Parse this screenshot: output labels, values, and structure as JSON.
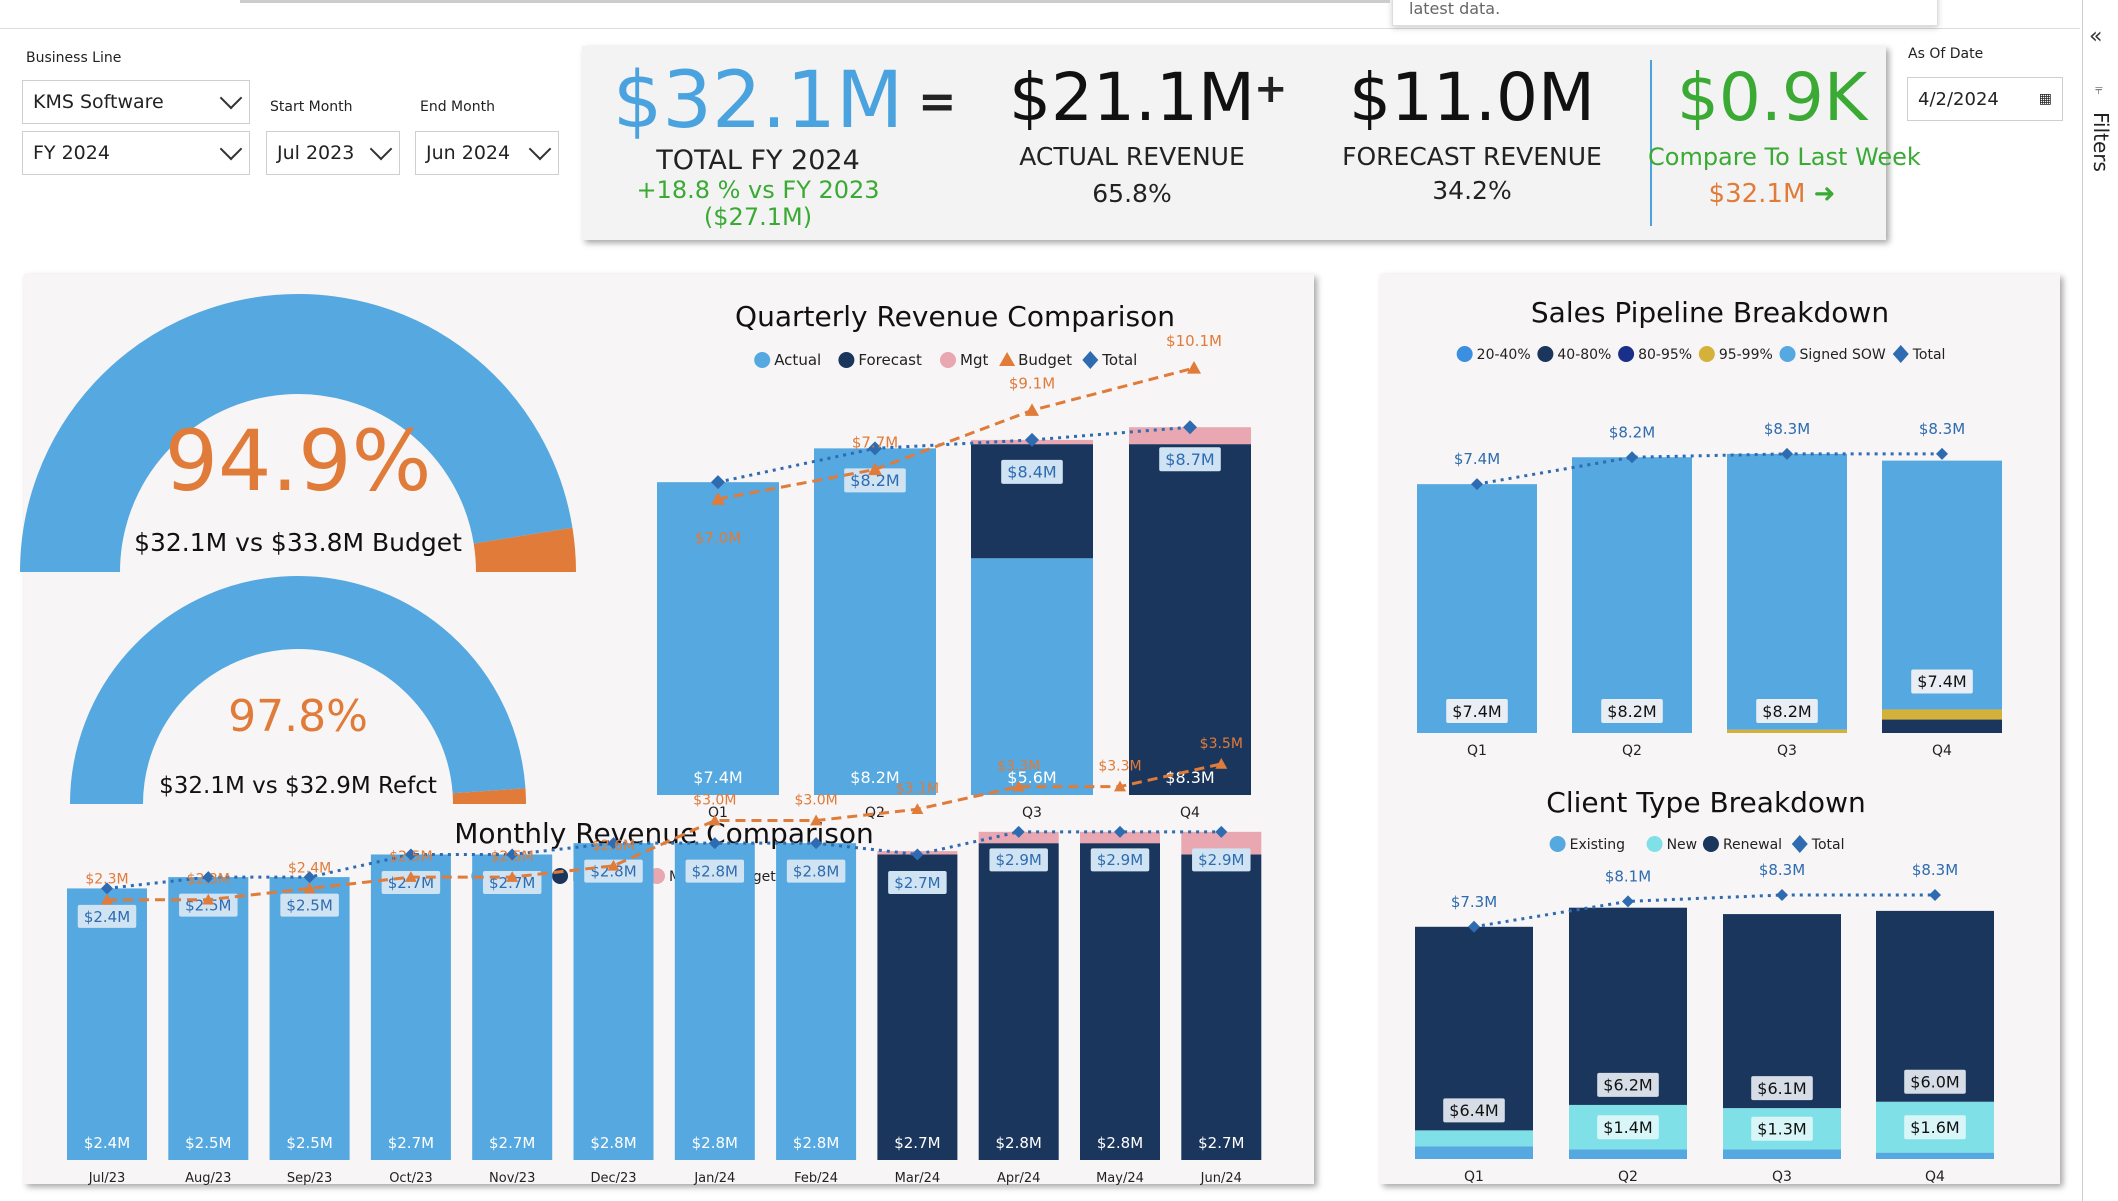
{
  "filters": {
    "business_line_label": "Business Line",
    "business_line_value": "KMS Software",
    "fiscal_year_value": "FY 2024",
    "start_month_label": "Start Month",
    "start_month_value": "Jul 2023",
    "end_month_label": "End Month",
    "end_month_value": "Jun 2024",
    "as_of_label": "As Of Date",
    "as_of_value": "4/2/2024",
    "filters_pane_label": "Filters",
    "tooltip_partial": "latest data."
  },
  "kpis": {
    "total_value": "$32.1M",
    "total_label": "TOTAL FY 2024",
    "total_change": "+18.8 % vs FY 2023",
    "total_prev": "($27.1M)",
    "equals": "=",
    "plus": "+",
    "actual_value": "$21.1M",
    "actual_label": "ACTUAL REVENUE",
    "actual_pct": "65.8%",
    "forecast_value": "$11.0M",
    "forecast_label": "FORECAST REVENUE",
    "forecast_pct": "34.2%",
    "week_value": "$0.9K",
    "week_label": "Compare To Last Week",
    "week_prev": "$32.1M",
    "colors": {
      "blue": "#4aa3df",
      "green": "#3aaa35",
      "orange": "#e07b39"
    }
  },
  "gauges": [
    {
      "pct_value": 94.9,
      "pct_text": "94.9%",
      "sub": "$32.1M vs $33.8M Budget"
    },
    {
      "pct_value": 97.8,
      "pct_text": "97.8%",
      "sub": "$32.1M vs $32.9M Refct"
    }
  ],
  "chart_data": [
    {
      "type": "bar",
      "title": "Quarterly Revenue Comparison",
      "legend": [
        "Actual",
        "Forecast",
        "Mgt",
        "Budget",
        "Total"
      ],
      "categories": [
        "Q1",
        "Q2",
        "Q3",
        "Q4"
      ],
      "series": [
        {
          "name": "Actual",
          "values": [
            7.4,
            8.2,
            5.6,
            0
          ],
          "labels": [
            "$7.4M",
            "$8.2M",
            "$5.6M",
            ""
          ]
        },
        {
          "name": "Forecast",
          "values": [
            0,
            0,
            2.7,
            8.3
          ],
          "labels": [
            "",
            "",
            "$2.7M",
            "$8.3M"
          ]
        },
        {
          "name": "Mgt",
          "values": [
            0,
            0,
            0.1,
            0.4
          ]
        },
        {
          "name": "Budget",
          "values": [
            7.0,
            7.7,
            9.1,
            10.1
          ],
          "labels": [
            "$7.0M",
            "$7.7M",
            "$9.1M",
            "$10.1M"
          ]
        },
        {
          "name": "Total",
          "values": [
            7.4,
            8.2,
            8.4,
            8.7
          ],
          "labels": [
            "",
            "$8.2M",
            "$8.4M",
            "$8.7M"
          ]
        }
      ],
      "ylim": [
        0,
        11
      ]
    },
    {
      "type": "bar",
      "title": "Monthly Revenue Comparison",
      "legend": [
        "Actual",
        "Forecast",
        "Mgt",
        "Budget",
        "Total"
      ],
      "categories": [
        "Jul/23",
        "Aug/23",
        "Sep/23",
        "Oct/23",
        "Nov/23",
        "Dec/23",
        "Jan/24",
        "Feb/24",
        "Mar/24",
        "Apr/24",
        "May/24",
        "Jun/24"
      ],
      "series": [
        {
          "name": "Actual",
          "values": [
            2.4,
            2.5,
            2.5,
            2.7,
            2.7,
            2.8,
            2.8,
            2.8,
            0,
            0,
            0,
            0
          ],
          "labels": [
            "$2.4M",
            "$2.5M",
            "$2.5M",
            "$2.7M",
            "$2.7M",
            "$2.8M",
            "$2.8M",
            "$2.8M",
            "",
            "",
            "",
            ""
          ]
        },
        {
          "name": "Forecast",
          "values": [
            0,
            0,
            0,
            0,
            0,
            0,
            0,
            0,
            2.7,
            2.8,
            2.8,
            2.7
          ],
          "labels": [
            "",
            "",
            "",
            "",
            "",
            "",
            "",
            "",
            "$2.7M",
            "$2.8M",
            "$2.8M",
            "$2.7M"
          ]
        },
        {
          "name": "Mgt",
          "values": [
            0,
            0,
            0,
            0,
            0,
            0,
            0,
            0,
            0.03,
            0.1,
            0.1,
            0.2
          ]
        },
        {
          "name": "Budget",
          "values": [
            2.3,
            2.3,
            2.4,
            2.5,
            2.5,
            2.6,
            3.0,
            3.0,
            3.1,
            3.3,
            3.3,
            3.5
          ],
          "labels": [
            "$2.3M",
            "$2.3M",
            "$2.4M",
            "$2.5M",
            "$2.5M",
            "$2.6M",
            "$3.0M",
            "$3.0M",
            "$3.1M",
            "$3.3M",
            "$3.3M",
            "$3.5M"
          ]
        },
        {
          "name": "Total",
          "values": [
            2.4,
            2.5,
            2.5,
            2.7,
            2.7,
            2.8,
            2.8,
            2.8,
            2.7,
            2.9,
            2.9,
            2.9
          ],
          "labels": [
            "$2.4M",
            "$2.5M",
            "$2.5M",
            "$2.7M",
            "$2.7M",
            "$2.8M",
            "$2.8M",
            "$2.8M",
            "$2.7M",
            "$2.9M",
            "$2.9M",
            "$2.9M"
          ]
        }
      ],
      "ylim": [
        0,
        3.8
      ]
    },
    {
      "type": "bar",
      "title": "Sales Pipeline Breakdown",
      "legend": [
        "20-40%",
        "40-80%",
        "80-95%",
        "95-99%",
        "Signed SOW",
        "Total"
      ],
      "categories": [
        "Q1",
        "Q2",
        "Q3",
        "Q4"
      ],
      "series": [
        {
          "name": "40-80%",
          "values": [
            0,
            0,
            0,
            0.4
          ]
        },
        {
          "name": "95-99%",
          "values": [
            0,
            0,
            0.1,
            0.3
          ]
        },
        {
          "name": "Signed SOW",
          "values": [
            7.4,
            8.2,
            8.2,
            7.4
          ],
          "labels": [
            "$7.4M",
            "$8.2M",
            "$8.2M",
            "$7.4M"
          ]
        },
        {
          "name": "Total",
          "values": [
            7.4,
            8.2,
            8.3,
            8.3
          ],
          "labels": [
            "$7.4M",
            "$8.2M",
            "$8.3M",
            "$8.3M"
          ]
        }
      ],
      "ylim": [
        0,
        10.2
      ]
    },
    {
      "type": "bar",
      "title": "Client Type Breakdown",
      "legend": [
        "Existing",
        "New",
        "Renewal",
        "Total"
      ],
      "categories": [
        "Q1",
        "Q2",
        "Q3",
        "Q4"
      ],
      "series": [
        {
          "name": "Existing",
          "values": [
            0.4,
            0.3,
            0.3,
            0.2
          ]
        },
        {
          "name": "New",
          "values": [
            0.5,
            1.4,
            1.3,
            1.6
          ],
          "labels": [
            "",
            "$1.4M",
            "$1.3M",
            "$1.6M"
          ]
        },
        {
          "name": "Renewal",
          "values": [
            6.4,
            6.2,
            6.1,
            6.0
          ],
          "labels": [
            "$6.4M",
            "$6.2M",
            "$6.1M",
            "$6.0M"
          ]
        },
        {
          "name": "Total",
          "values": [
            7.3,
            8.1,
            8.3,
            8.3
          ],
          "labels": [
            "$7.3M",
            "$8.1M",
            "$8.3M",
            "$8.3M"
          ]
        }
      ],
      "ylim": [
        0,
        9.4
      ]
    }
  ]
}
